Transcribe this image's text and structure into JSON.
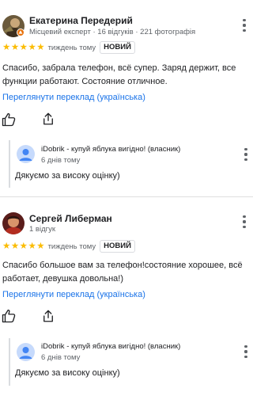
{
  "reviews": [
    {
      "author": "Екатерина Передерий",
      "author_meta": "Місцевий експерт · 16 відгуків · 221 фотографія",
      "rating": 5,
      "stars": [
        "★",
        "★",
        "★",
        "★",
        "★"
      ],
      "time": "тиждень тому",
      "badge": "НОВИЙ",
      "text": "Спасибо, забрала телефон, всё супер. Заряд держит, все функции работают. Состояние отличное.",
      "translate_link": "Переглянути переклад (українська)",
      "owner_reply": {
        "owner": "iDobrik - купуй яблука вигідно! (власник)",
        "time": "6 днів тому",
        "text": "Дякуємо за високу оцінку)"
      }
    },
    {
      "author": "Сергей Либерман",
      "author_meta": "1 відгук",
      "rating": 5,
      "stars": [
        "★",
        "★",
        "★",
        "★",
        "★"
      ],
      "time": "тиждень тому",
      "badge": "НОВИЙ",
      "text": "Спасибо большое вам за телефон!состояние хорошее, всё работает, девушка довольна!)",
      "translate_link": "Переглянути переклад (українська)",
      "owner_reply": {
        "owner": "iDobrik - купуй яблука вигідно! (власник)",
        "time": "6 днів тому",
        "text": "Дякуємо за високу оцінку)"
      }
    }
  ],
  "icons": {
    "more": "more-vert-icon",
    "like": "thumb-up-icon",
    "share": "share-icon",
    "star": "star-icon",
    "local_guide": "local-guide-badge-icon"
  },
  "colors": {
    "star": "#fbbc04",
    "link": "#1a73e8",
    "secondary_text": "#5f6368",
    "divider": "#e0e0e0",
    "local_guide_badge": "#e8710a",
    "owner_avatar": "#4285f4"
  }
}
